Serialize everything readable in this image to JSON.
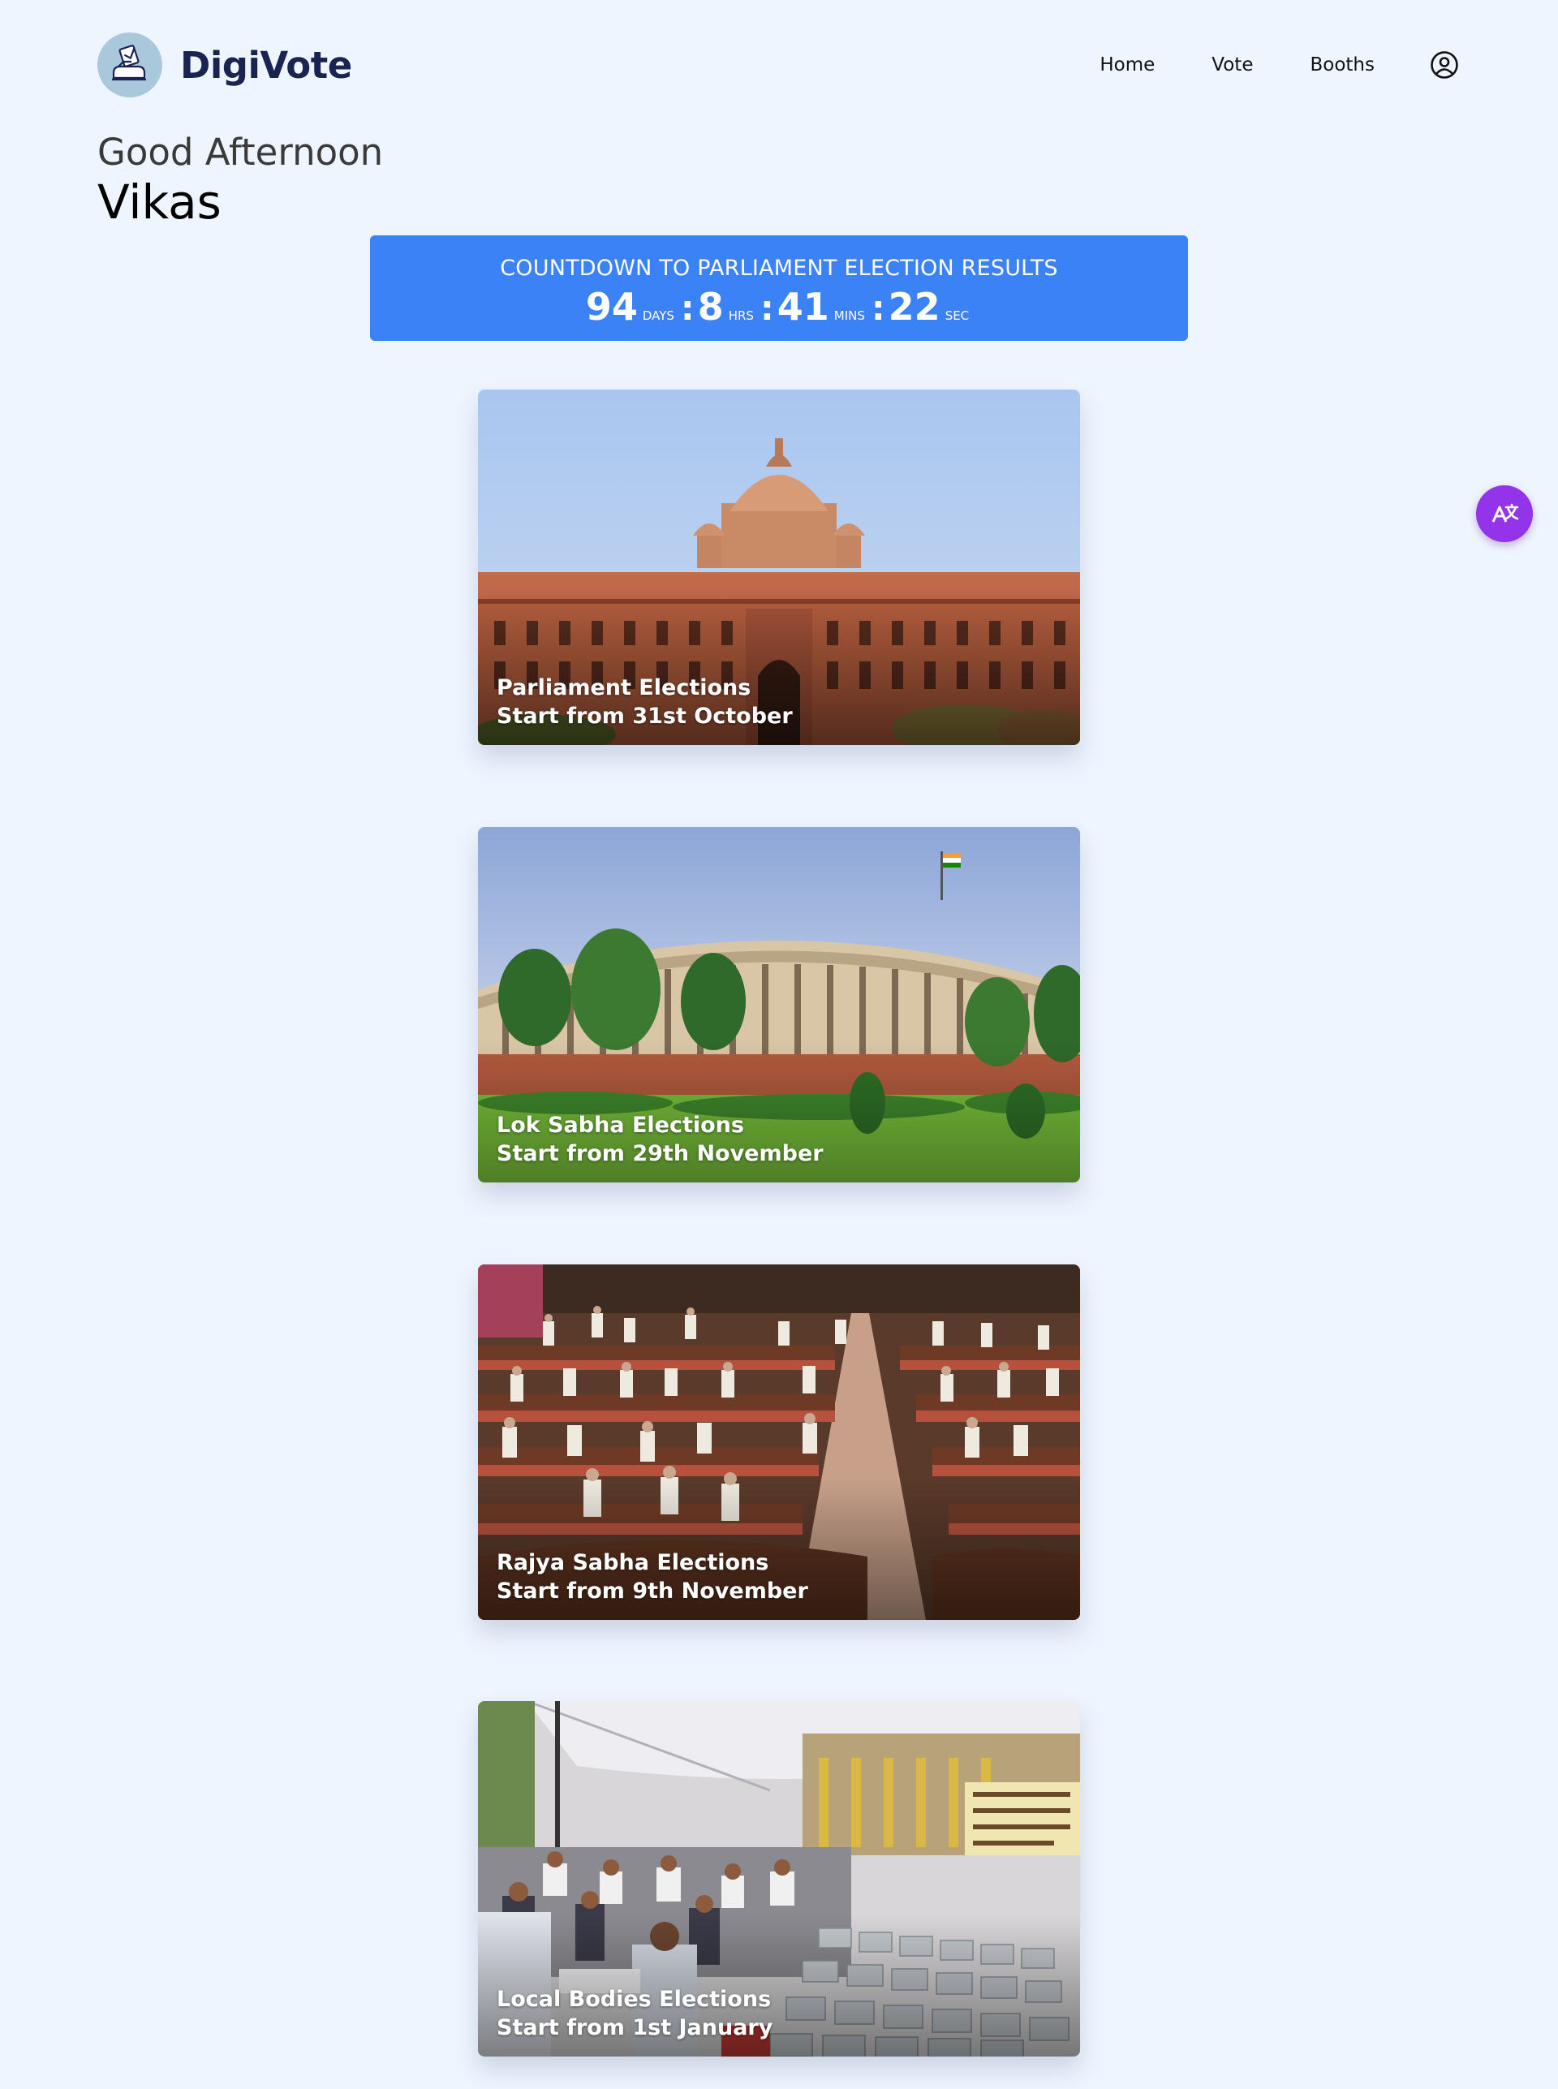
{
  "brand": {
    "name": "DigiVote",
    "logo_icon": "ballot-box-icon"
  },
  "nav": {
    "items": [
      {
        "label": "Home"
      },
      {
        "label": "Vote"
      },
      {
        "label": "Booths"
      }
    ],
    "profile_icon": "user-circle-icon"
  },
  "greeting": {
    "salutation": "Good Afternoon",
    "name": "Vikas"
  },
  "countdown": {
    "title": "COUNTDOWN TO PARLIAMENT ELECTION RESULTS",
    "days": "94",
    "days_unit": "DAYS",
    "hours": "8",
    "hours_unit": "HRS",
    "minutes": "41",
    "minutes_unit": "MINS",
    "seconds": "22",
    "seconds_unit": "SEC",
    "separator": ":",
    "color": "#3b82f6"
  },
  "elections": [
    {
      "title": "Parliament Elections",
      "subtitle": "Start from 31st October"
    },
    {
      "title": "Lok Sabha Elections",
      "subtitle": "Start from 29th November"
    },
    {
      "title": "Rajya Sabha Elections",
      "subtitle": "Start from 9th November"
    },
    {
      "title": "Local Bodies Elections",
      "subtitle": "Start from 1st January"
    }
  ],
  "translate_button": {
    "icon": "translate-icon",
    "color": "#9333ea"
  },
  "colors": {
    "background": "#eff5ff",
    "brand_text": "#1a2453",
    "logo_bg": "#a9c8dc"
  }
}
